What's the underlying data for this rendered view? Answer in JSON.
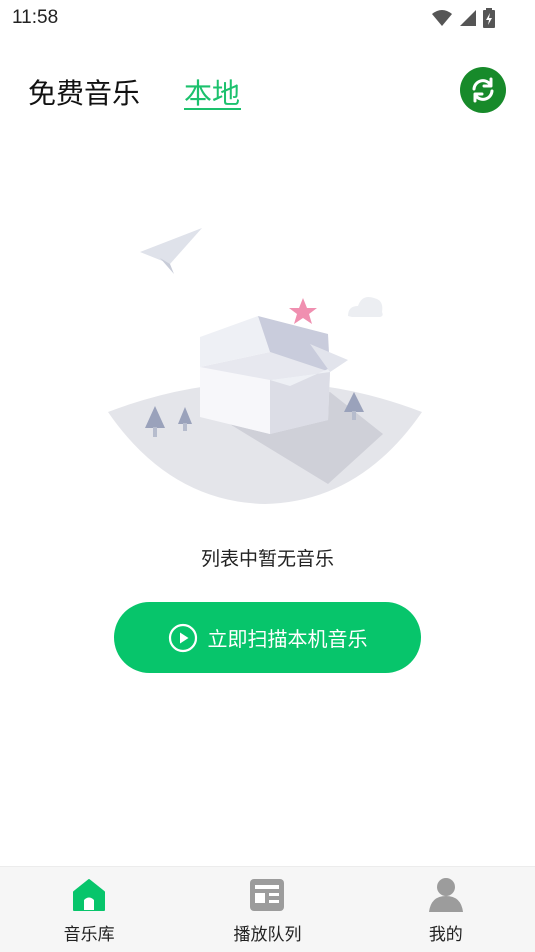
{
  "status_bar": {
    "time": "11:58",
    "icons": [
      "wifi-icon",
      "signal-icon",
      "battery-icon"
    ]
  },
  "tabs": [
    {
      "label": "免费音乐",
      "active": false
    },
    {
      "label": "本地",
      "active": true
    }
  ],
  "header": {
    "refresh_icon": "refresh-icon"
  },
  "empty_state": {
    "message": "列表中暂无音乐",
    "scan_button_label": "立即扫描本机音乐",
    "scan_button_icon": "play-circle-icon"
  },
  "bottom_nav": [
    {
      "label": "音乐库",
      "icon": "home-icon",
      "active": true
    },
    {
      "label": "播放队列",
      "icon": "queue-icon",
      "active": false
    },
    {
      "label": "我的",
      "icon": "profile-icon",
      "active": false
    }
  ],
  "colors": {
    "accent": "#07c56b",
    "active_tab": "#1cc16d",
    "refresh_bg": "#178a2a"
  }
}
